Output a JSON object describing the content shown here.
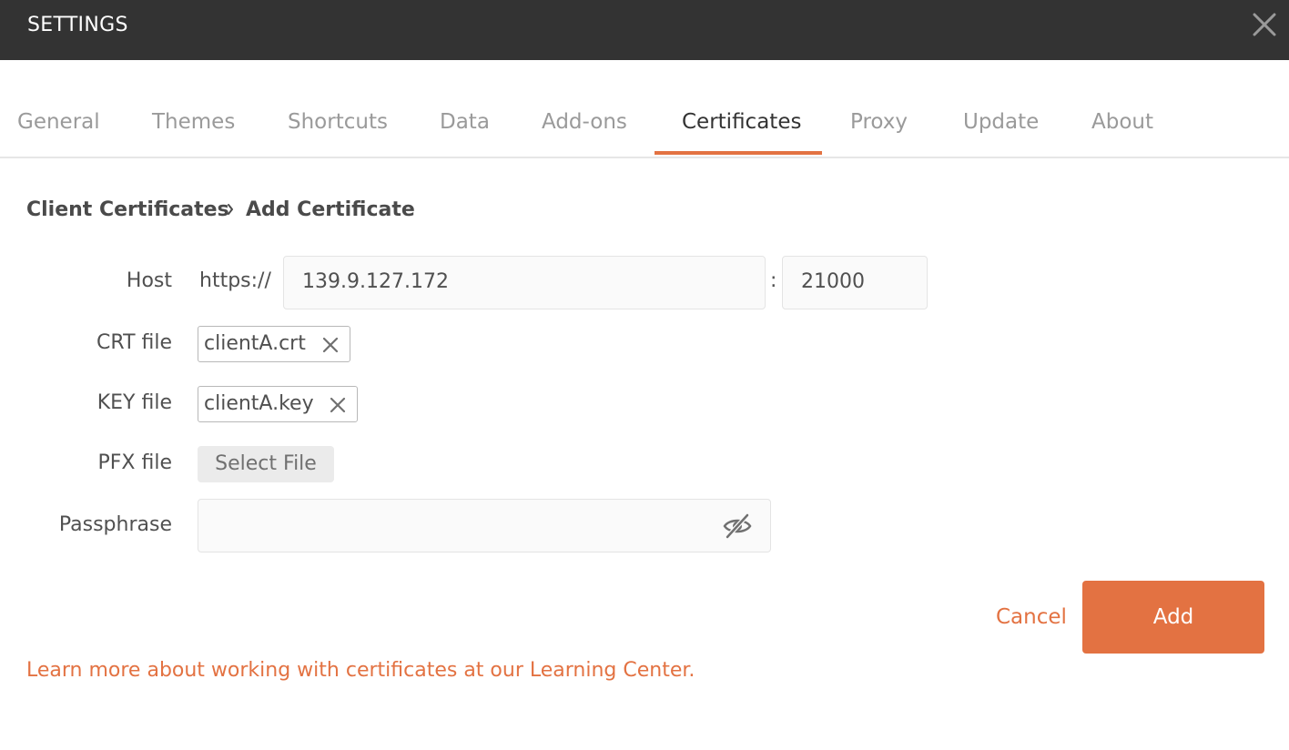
{
  "window": {
    "title": "SETTINGS",
    "close_icon": "close-icon"
  },
  "tabs": [
    {
      "label": "General"
    },
    {
      "label": "Themes"
    },
    {
      "label": "Shortcuts"
    },
    {
      "label": "Data"
    },
    {
      "label": "Add-ons"
    },
    {
      "label": "Certificates",
      "active": true
    },
    {
      "label": "Proxy"
    },
    {
      "label": "Update"
    },
    {
      "label": "About"
    }
  ],
  "breadcrumb": {
    "parent": "Client Certificates",
    "separator_icon": "chevron-right-icon",
    "current": "Add Certificate"
  },
  "form": {
    "host": {
      "label": "Host",
      "prefix": "https://",
      "value": "139.9.127.172",
      "separator": ":",
      "port": "21000"
    },
    "crt": {
      "label": "CRT file",
      "file": "clientA.crt",
      "remove_icon": "remove-x-icon"
    },
    "key": {
      "label": "KEY file",
      "file": "clientA.key",
      "remove_icon": "remove-x-icon"
    },
    "pfx": {
      "label": "PFX file",
      "button": "Select File"
    },
    "passphrase": {
      "label": "Passphrase",
      "value": "",
      "toggle_icon": "eye-slash-icon"
    }
  },
  "actions": {
    "cancel": "Cancel",
    "add": "Add"
  },
  "learn_more": "Learn more about working with certificates at our Learning Center.",
  "colors": {
    "accent": "#e37242",
    "titlebar": "#333333",
    "input_bg": "#fafafa"
  }
}
